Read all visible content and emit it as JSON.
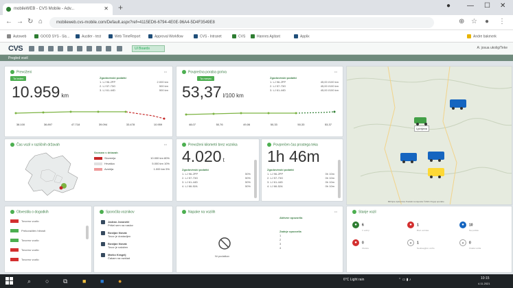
{
  "browser": {
    "tab_title": "mobileWEB - CVS Mobile - Adv...",
    "url": "mobileweb.cvs-mobile.com/Default.aspx?ref=4115ED6-6794-4E0E-96A4-5D4F3549E8",
    "bookmarks": [
      "Autoweb",
      "GOOD SYS - Sis...",
      "Austler - test",
      "Web TimeReport",
      "Approval Workflow",
      "CVS - Intranet",
      "CVS",
      "Hannes Agitant",
      "Applix",
      "Andre bakmerk"
    ]
  },
  "app": {
    "logo": "CVS",
    "dropdown": "Ul Boards",
    "user": "A: josua ukolig/Teke",
    "breadcrumb": "Pregled vozil"
  },
  "mileage": {
    "title": "Prevoženi",
    "badge": "Ta teden",
    "value": "10.959",
    "unit": "km",
    "list_head": "Zgodovinski podatki",
    "rows": [
      [
        "1. LJ 96-2PP",
        "2.000 km"
      ],
      [
        "2. LJ 57-73G",
        "500 km"
      ],
      [
        "3. LJ 61-44D",
        "500 km"
      ]
    ],
    "trend_values": [
      "38.100",
      "36.897",
      "47.718",
      "39.094",
      "33.478",
      "10.959"
    ]
  },
  "consumption": {
    "title": "Povprečna poraba goriva",
    "badge": "Ta mesec",
    "value": "53,37",
    "unit": "l/100 km",
    "list_head": "Zgodovinski podatki",
    "rows": [
      [
        "1. LJ 96-2PP",
        "45,00 l/100 km"
      ],
      [
        "2. LJ 57-73G",
        "45,00 l/100 km"
      ],
      [
        "3. LJ 61-44D",
        "45,00 l/100 km"
      ]
    ],
    "trend_values": [
      "48,07",
      "50,76",
      "49,06",
      "50,33",
      "50,33",
      "53,37"
    ]
  },
  "countries": {
    "title": "Čas vozil v različnih državah",
    "list_head": "Seznam v državah",
    "rows": [
      [
        "Slovenija",
        "10.000 km",
        "80%"
      ],
      [
        "Hrvaška",
        "5.000 km",
        "10%"
      ],
      [
        "Avstrija",
        "1.000 km",
        "5%"
      ]
    ]
  },
  "driven_time": {
    "title": "Prevoženi kilometri brez voznika",
    "value": "4.020",
    "unit": "t",
    "list_head": "Zgodovinski podatki",
    "rows": [
      [
        "1. LJ 96-2PP",
        "50%"
      ],
      [
        "2. LJ 57-73G",
        "50%"
      ],
      [
        "3. LJ 61-44D",
        "50%"
      ],
      [
        "4. LJ 66-52A",
        "50%"
      ]
    ]
  },
  "idle": {
    "title": "Povprečen čas prostega teka",
    "value": "1h 46m",
    "list_head": "Zgodovinski podatki",
    "rows": [
      [
        "1. LJ 96-2PP",
        "0h 10m"
      ],
      [
        "2. LJ 57-73G",
        "0h 10m"
      ],
      [
        "3. LJ 61-44D",
        "0h 10m"
      ],
      [
        "4. LJ 66-52A",
        "0h 10m"
      ]
    ]
  },
  "map": {
    "label": "Ljubljana",
    "footer": "Bližnjice tipkovnice   Podatki zemljevida ©2021   Pogoji uporabe"
  },
  "notices": {
    "title": "Obvestila o dogodkih",
    "items": [
      "Tovorno vozilo",
      "Prekoračitev hitrosti",
      "Tovorno vozilo",
      "Tovorno vozilo",
      "Tovorno vozilo"
    ]
  },
  "messages": {
    "title": "Sporočila voznikov",
    "items": [
      [
        "Jadran Jovančič",
        "Prišel sem na naslov"
      ],
      [
        "Bostjan Novak",
        "Tovor je dostavljen"
      ],
      [
        "Bostjan Novak",
        "Tovor je naložen"
      ],
      [
        "Marko Kragelj",
        "Čakam na razklad"
      ]
    ]
  },
  "alerts": {
    "title": "Napake na vozilih",
    "empty": "Ni podatkov",
    "legend": [
      "Aktivne opozorila",
      "Zadnje opozorila"
    ],
    "list": [
      "1",
      "2",
      "3",
      "4"
    ]
  },
  "fleet": {
    "title": "Stanje vozil",
    "items": [
      {
        "count": "6",
        "label": "V vožnji",
        "color": "#2e7d32"
      },
      {
        "count": "1",
        "label": "Brez voznika",
        "color": "#d32f2f"
      },
      {
        "count": "10",
        "label": "Na počitku",
        "color": "#1565c0"
      },
      {
        "count": "0",
        "label": "Okvara",
        "color": "#d32f2f"
      },
      {
        "count": "1",
        "label": "Nedosegljivo vozilo",
        "color": "#9e9e9e"
      },
      {
        "count": "0",
        "label": "Ostala vozila",
        "color": "#9e9e9e"
      }
    ]
  },
  "taskbar": {
    "weather": "6°C Light rain",
    "time": "10:15",
    "date": "4.11.2021"
  },
  "colors": {
    "accent": "#4caf50",
    "dark": "#2c3e50"
  }
}
